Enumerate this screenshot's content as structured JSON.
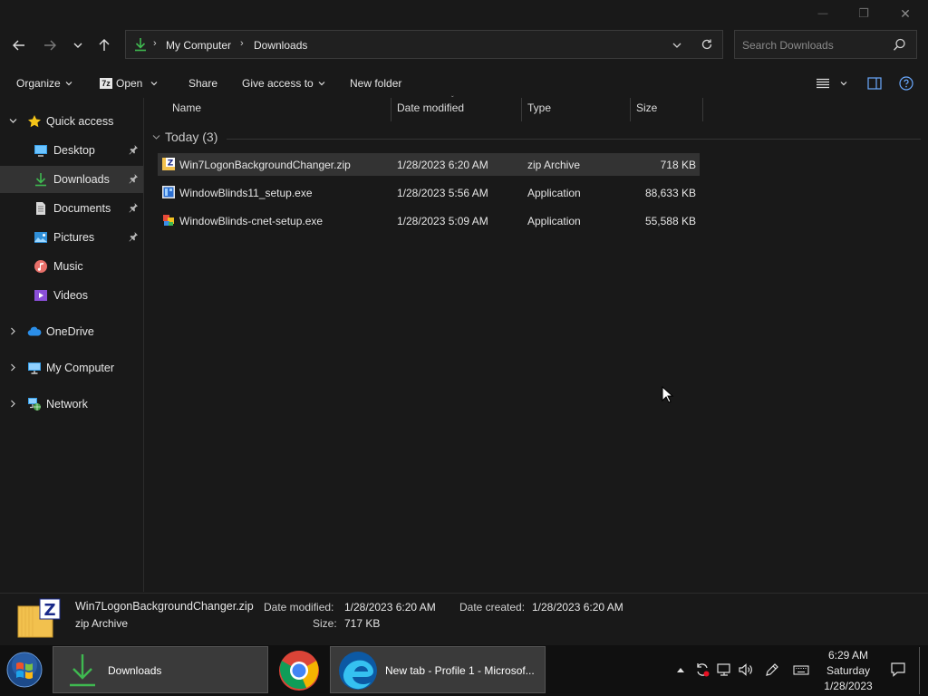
{
  "window": {
    "minimize_glyph": "—",
    "restore_glyph": "❐",
    "close_glyph": "✕"
  },
  "address": {
    "segments": [
      "My Computer",
      "Downloads"
    ],
    "search_placeholder": "Search Downloads"
  },
  "toolbar": {
    "organize": "Organize",
    "open": "Open",
    "share": "Share",
    "give_access": "Give access to",
    "new_folder": "New folder"
  },
  "navpane": {
    "quick_access": "Quick access",
    "desktop": "Desktop",
    "downloads": "Downloads",
    "documents": "Documents",
    "pictures": "Pictures",
    "music": "Music",
    "videos": "Videos",
    "onedrive": "OneDrive",
    "my_computer": "My Computer",
    "network": "Network"
  },
  "columns": {
    "name": "Name",
    "date_modified": "Date modified",
    "type": "Type",
    "size": "Size"
  },
  "group": {
    "label": "Today (3)"
  },
  "files": [
    {
      "name": "Win7LogonBackgroundChanger.zip",
      "date": "1/28/2023 6:20 AM",
      "type": "zip Archive",
      "size": "718 KB"
    },
    {
      "name": "WindowBlinds11_setup.exe",
      "date": "1/28/2023 5:56 AM",
      "type": "Application",
      "size": "88,633 KB"
    },
    {
      "name": "WindowBlinds-cnet-setup.exe",
      "date": "1/28/2023 5:09 AM",
      "type": "Application",
      "size": "55,588 KB"
    }
  ],
  "details": {
    "filename": "Win7LogonBackgroundChanger.zip",
    "filetype": "zip Archive",
    "date_modified_label": "Date modified:",
    "date_modified_value": "1/28/2023 6:20 AM",
    "date_created_label": "Date created:",
    "date_created_value": "1/28/2023 6:20 AM",
    "size_label": "Size:",
    "size_value": "717 KB"
  },
  "taskbar": {
    "explorer_label": "Downloads",
    "edge_label": "New tab - Profile 1 - Microsof...",
    "clock_time": "6:29 AM",
    "clock_day": "Saturday",
    "clock_date": "1/28/2023"
  },
  "colors": {
    "background": "#191919",
    "selection": "#333333",
    "download_green": "#3fb950",
    "folder_yellow": "#f2c14e"
  }
}
